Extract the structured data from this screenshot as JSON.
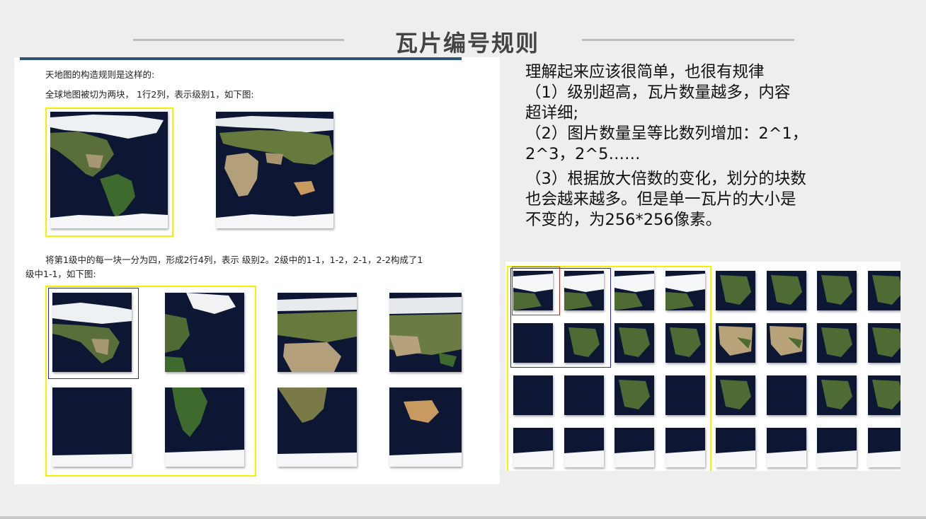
{
  "slide": {
    "title": "瓦片编号规则"
  },
  "document": {
    "line1": "天地图的构造规则是这样的:",
    "line2": "全球地图被切为两块， 1行2列，表示级别1，如下图:",
    "line3": "将第1级中的每一块一分为四，形成2行4列，表示 级别2。2级中的1-1，1-2，2-1，2-2构成了1",
    "line4": "级中1-1，如下图:"
  },
  "explanation": {
    "heading": "理解起来应该很简单，也很有规律",
    "point1a": "（1）级别超高，瓦片数量越多，内容",
    "point1b": "超详细;",
    "point2a": "（2）图片数量呈等比数列增加：2^1，",
    "point2b": "2^3，2^5……",
    "point3a": "（3）根据放大倍数的变化，划分的块数",
    "point3b": "也会越来越多。但是单一瓦片的大小是",
    "point3c": "不变的，为256*256像素。"
  },
  "colors": {
    "ocean": "#0d1633",
    "land": "#4e6b34",
    "desert": "#b8a27a",
    "ice": "#f4f6f8",
    "highlight_yellow": "#f4f000",
    "highlight_blue": "#2424d8",
    "highlight_red": "#e02020",
    "accent_bar": "#2e5478"
  }
}
